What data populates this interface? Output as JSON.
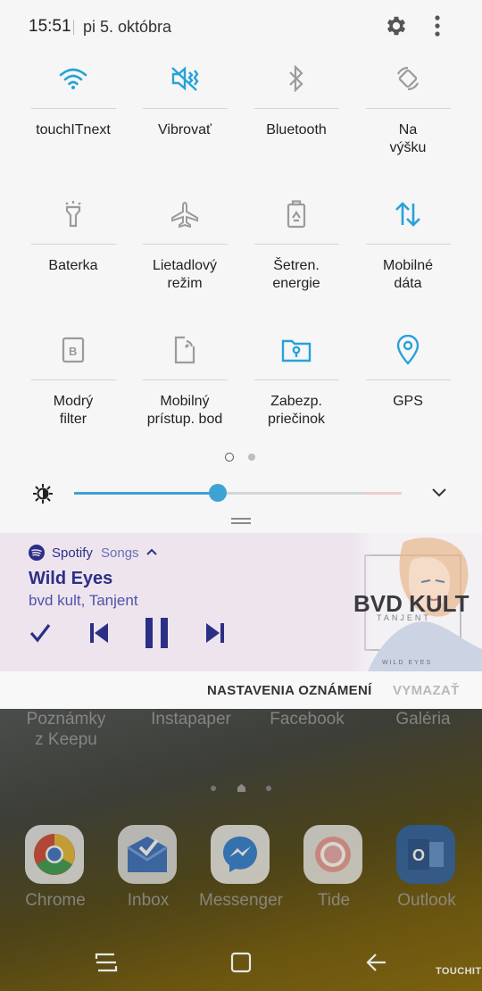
{
  "status": {
    "time": "15:51",
    "date": "pi 5. októbra"
  },
  "quick_settings": [
    {
      "icon": "wifi-icon",
      "label": "touchITnext",
      "active": true
    },
    {
      "icon": "vibrate-icon",
      "label": "Vibrovať",
      "active": true
    },
    {
      "icon": "bluetooth-icon",
      "label": "Bluetooth",
      "active": false
    },
    {
      "icon": "rotation-icon",
      "label": "Na výšku",
      "active": false
    },
    {
      "icon": "flashlight-icon",
      "label": "Baterka",
      "active": false
    },
    {
      "icon": "airplane-icon",
      "label": "Lietadlový režim",
      "active": false
    },
    {
      "icon": "power-saving-icon",
      "label": "Šetren. energie",
      "active": false
    },
    {
      "icon": "mobile-data-icon",
      "label": "Mobilné dáta",
      "active": true
    },
    {
      "icon": "blue-light-filter-icon",
      "label": "Modrý filter",
      "active": false
    },
    {
      "icon": "mobile-hotspot-icon",
      "label": "Mobilný prístup. bod",
      "active": false
    },
    {
      "icon": "secure-folder-icon",
      "label": "Zabezp. priečinok",
      "active": true
    },
    {
      "icon": "gps-icon",
      "label": "GPS",
      "active": true
    }
  ],
  "brightness": {
    "level": 0.44
  },
  "notification": {
    "app": "Spotify",
    "sub": "Songs",
    "title": "Wild Eyes",
    "artist": "bvd kult, Tanjent",
    "album_text": {
      "line1": "BVD KULT",
      "line2": "TANJENT",
      "line3": "WILD EYES"
    }
  },
  "actions": {
    "settings": "NASTAVENIA OZNÁMENÍ",
    "clear": "VYMAZAŤ"
  },
  "home": {
    "labels_top": [
      "Poznámky\nz Keepu",
      "Instapaper",
      "Facebook",
      "Galéria"
    ],
    "dock": [
      "Chrome",
      "Inbox",
      "Messenger",
      "Tide",
      "Outlook"
    ]
  },
  "watermark": "TOUCHIT",
  "colors": {
    "accent": "#27a2d8",
    "inactive": "#9b9b9b",
    "spotify": "#2c2f86"
  }
}
